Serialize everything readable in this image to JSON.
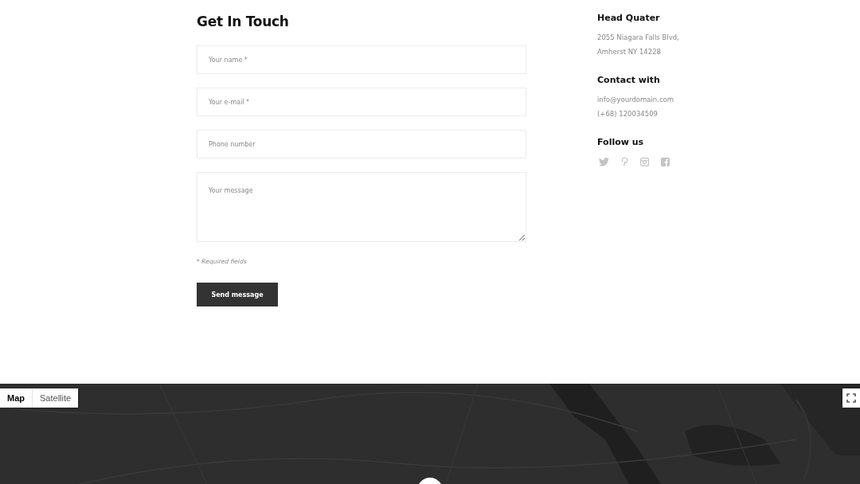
{
  "form": {
    "title": "Get In Touch",
    "fields": [
      {
        "kind": "input",
        "placeholder": "Your name *"
      },
      {
        "kind": "input",
        "placeholder": "Your e-mail *"
      },
      {
        "kind": "input",
        "placeholder": "Phone number"
      },
      {
        "kind": "textarea",
        "placeholder": "Your message"
      }
    ],
    "note": "* Required fields",
    "submit": "Send message"
  },
  "info": [
    {
      "heading": "Head Quater",
      "lines": [
        "2055 Niagara Falls Blvd,",
        "Amherst NY 14228"
      ]
    },
    {
      "heading": "Contact with",
      "lines": [
        "info@yourdomain.com",
        "(+68) 120034509"
      ]
    },
    {
      "heading": "Follow us",
      "socials": [
        {
          "kind": "twitter"
        },
        {
          "kind": "pinterest"
        },
        {
          "kind": "instagram"
        },
        {
          "kind": "facebook"
        }
      ]
    }
  ],
  "map": {
    "kind": "picture",
    "tabs": [
      {
        "label": "Map",
        "selected": true
      },
      {
        "label": "Satellite",
        "selected": false
      }
    ]
  }
}
